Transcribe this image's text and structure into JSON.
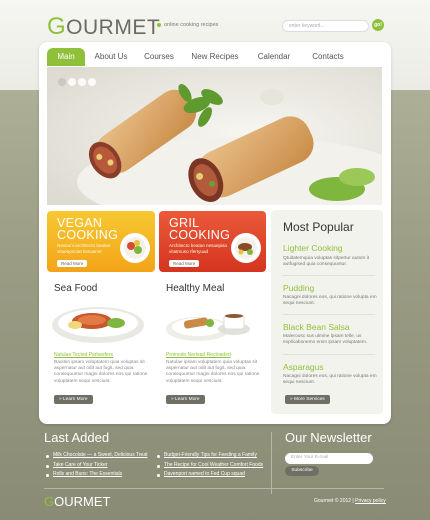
{
  "brand": {
    "logo_initial": "G",
    "logo_rest": "OURMET",
    "tagline": "online cooking recipes"
  },
  "search": {
    "placeholder": "enter keyword...",
    "button_label": "go!"
  },
  "nav": {
    "items": [
      "Main",
      "About Us",
      "Courses",
      "New Recipes",
      "Calendar",
      "Contacts"
    ],
    "active": "Main"
  },
  "slider": {
    "dot_count": 4
  },
  "promos": [
    {
      "title_line1": "VEGAN",
      "title_line2": "COOKING",
      "text": "Nesauni architecto beatae vitaenprictat kenusner",
      "button": "Read More",
      "color": "#f3a419"
    },
    {
      "title_line1": "GRIL",
      "title_line2": "COOKING",
      "text": "Architecto beatae nesaepisa vitatmuso rfertyuad",
      "button": "Read More",
      "color": "#d5351f"
    }
  ],
  "features": [
    {
      "title": "Sea Food",
      "link": "Natulae Tected Partaoifere",
      "text": "Baoitim ipsam voluptatem quia voluptas sit aspernatur aut odit aut fugit, sed quia consequuntur magni dolores eos qui ratione voluptatem sequi nesciunt.",
      "button": "» Learn More"
    },
    {
      "title": "Healthy Meal",
      "link": "Promodo Nertsad Rectoaded",
      "text": "Natulae ipsam voluptatem quia voluptas sit aspernatur aut odit aut fugit, sed quia consequuntur magni dolores eos qui ratione voluptatem sequi nesciunt.",
      "button": "» Learn More"
    }
  ],
  "popular": {
    "title": "Most Popular",
    "items": [
      {
        "title": "Lighter Cooking",
        "text": "Qtuitatemquia voluptas sitpertur autom it autfugised quia consequuntur."
      },
      {
        "title": "Pudding",
        "text": "Nacagni dolores eos, qui ratione volupta em sequi nesciunt."
      },
      {
        "title": "Black Bean Salsa",
        "text": "Maleroosc sus ulmine lpsam telle, us explicabonemo enim ipsam voluptatem."
      },
      {
        "title": "Asparagus",
        "text": "Nacagni dolores eos, qui ratione volupta em sequi nesciunt."
      }
    ],
    "button": "» More Services"
  },
  "last_added": {
    "title": "Last Added",
    "links": [
      "Milk Chocolate — a Sweet, Delicious Treat",
      "Take Care of Your Ticker",
      "Rolls and Buns: The Essentials",
      "Budget-Friendly Tips for Feeding a Family",
      "The Recipe for Cool Weather Comfort Foods",
      "Davenport named to Fed Cup squad"
    ]
  },
  "newsletter": {
    "title": "Our Newsletter",
    "placeholder": "Enter Your E-mail",
    "button": "Subscribe"
  },
  "footer": {
    "logo_initial": "G",
    "logo_rest": "OURMET",
    "copyright": "Gourmet © 2012 | ",
    "privacy": "Privacy policy"
  },
  "colors": {
    "accent": "#8fc03a",
    "olive": "#9b9c84",
    "dark_button": "#6f6f66"
  }
}
